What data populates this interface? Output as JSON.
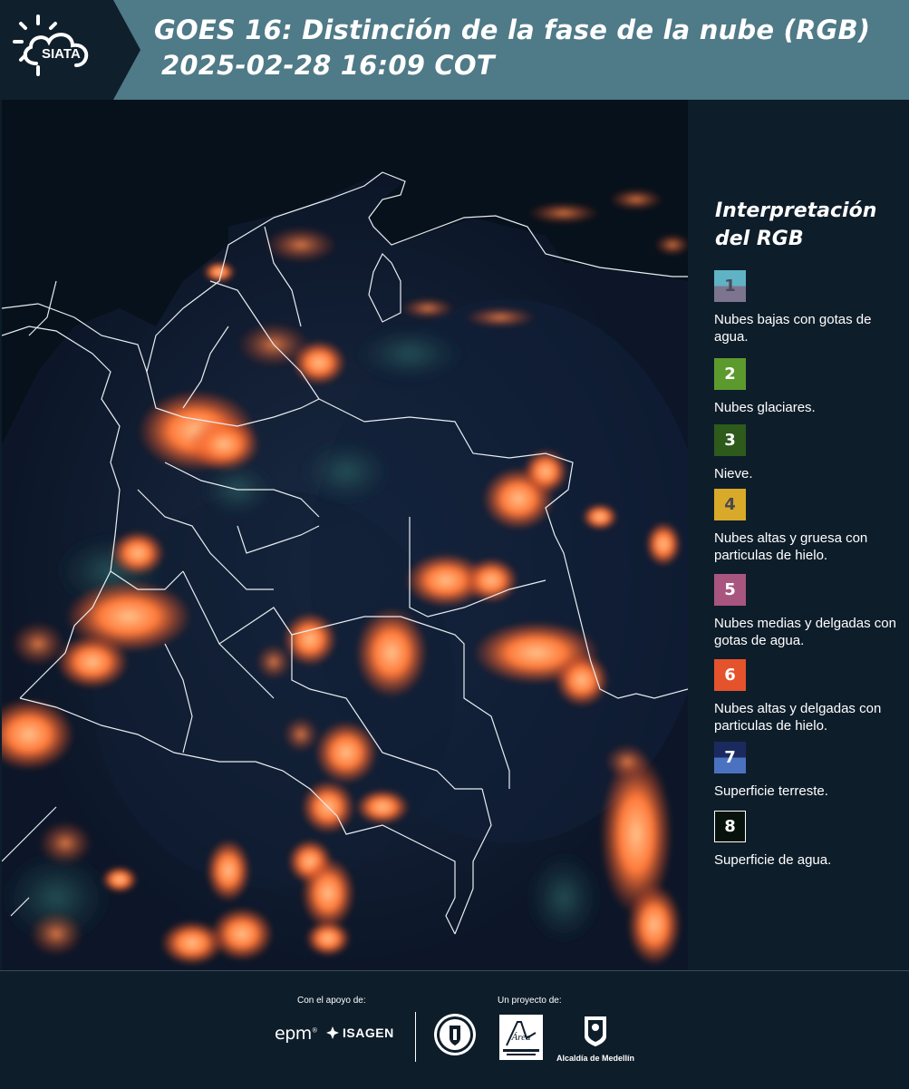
{
  "header": {
    "logo_text": "SIATA",
    "title_line1": "GOES 16: Distinción de la fase de la nube (RGB)",
    "title_line2": "2025-02-28 16:09 COT"
  },
  "legend": {
    "title": "Interpretación del RGB",
    "items": [
      {
        "num": "1",
        "label": "Nubes bajas con gotas de agua.",
        "top_color": "#5fb3c4",
        "bottom_color": "#7d7590",
        "num_color": "#4a4a5a"
      },
      {
        "num": "2",
        "label": "Nubes glaciares.",
        "color": "#5c9a2e",
        "num_color": "#ffffff"
      },
      {
        "num": "3",
        "label": "Nieve.",
        "color": "#2e5a1c",
        "num_color": "#ffffff"
      },
      {
        "num": "4",
        "label": "Nubes altas y gruesa con particulas de hielo.",
        "color": "#d9a92a",
        "num_color": "#4a4a4a"
      },
      {
        "num": "5",
        "label": "Nubes medias y delgadas con gotas de agua.",
        "color": "#a8567f",
        "num_color": "#ffffff"
      },
      {
        "num": "6",
        "label": "Nubes altas y delgadas con particulas de hielo.",
        "color": "#e4532c",
        "num_color": "#ffffff"
      },
      {
        "num": "7",
        "label": "Superficie terreste.",
        "top_color": "#1a2a5e",
        "bottom_color": "#4a72c0",
        "num_color": "#ffffff"
      },
      {
        "num": "8",
        "label": "Superficie de agua.",
        "color": "#07120c",
        "num_color": "#ffffff"
      }
    ]
  },
  "footer": {
    "support_label": "Con el apoyo de:",
    "project_label": "Un proyecto de:",
    "epm": "epm",
    "isagen": "ISAGEN",
    "area_name": "Área",
    "alcaldia": "Alcaldía de Medellín"
  },
  "colors": {
    "header_bg": "#4f7a87",
    "page_bg": "#0e1d2a",
    "cloud_ice": "#ff6a2a",
    "water": "#08121c"
  }
}
